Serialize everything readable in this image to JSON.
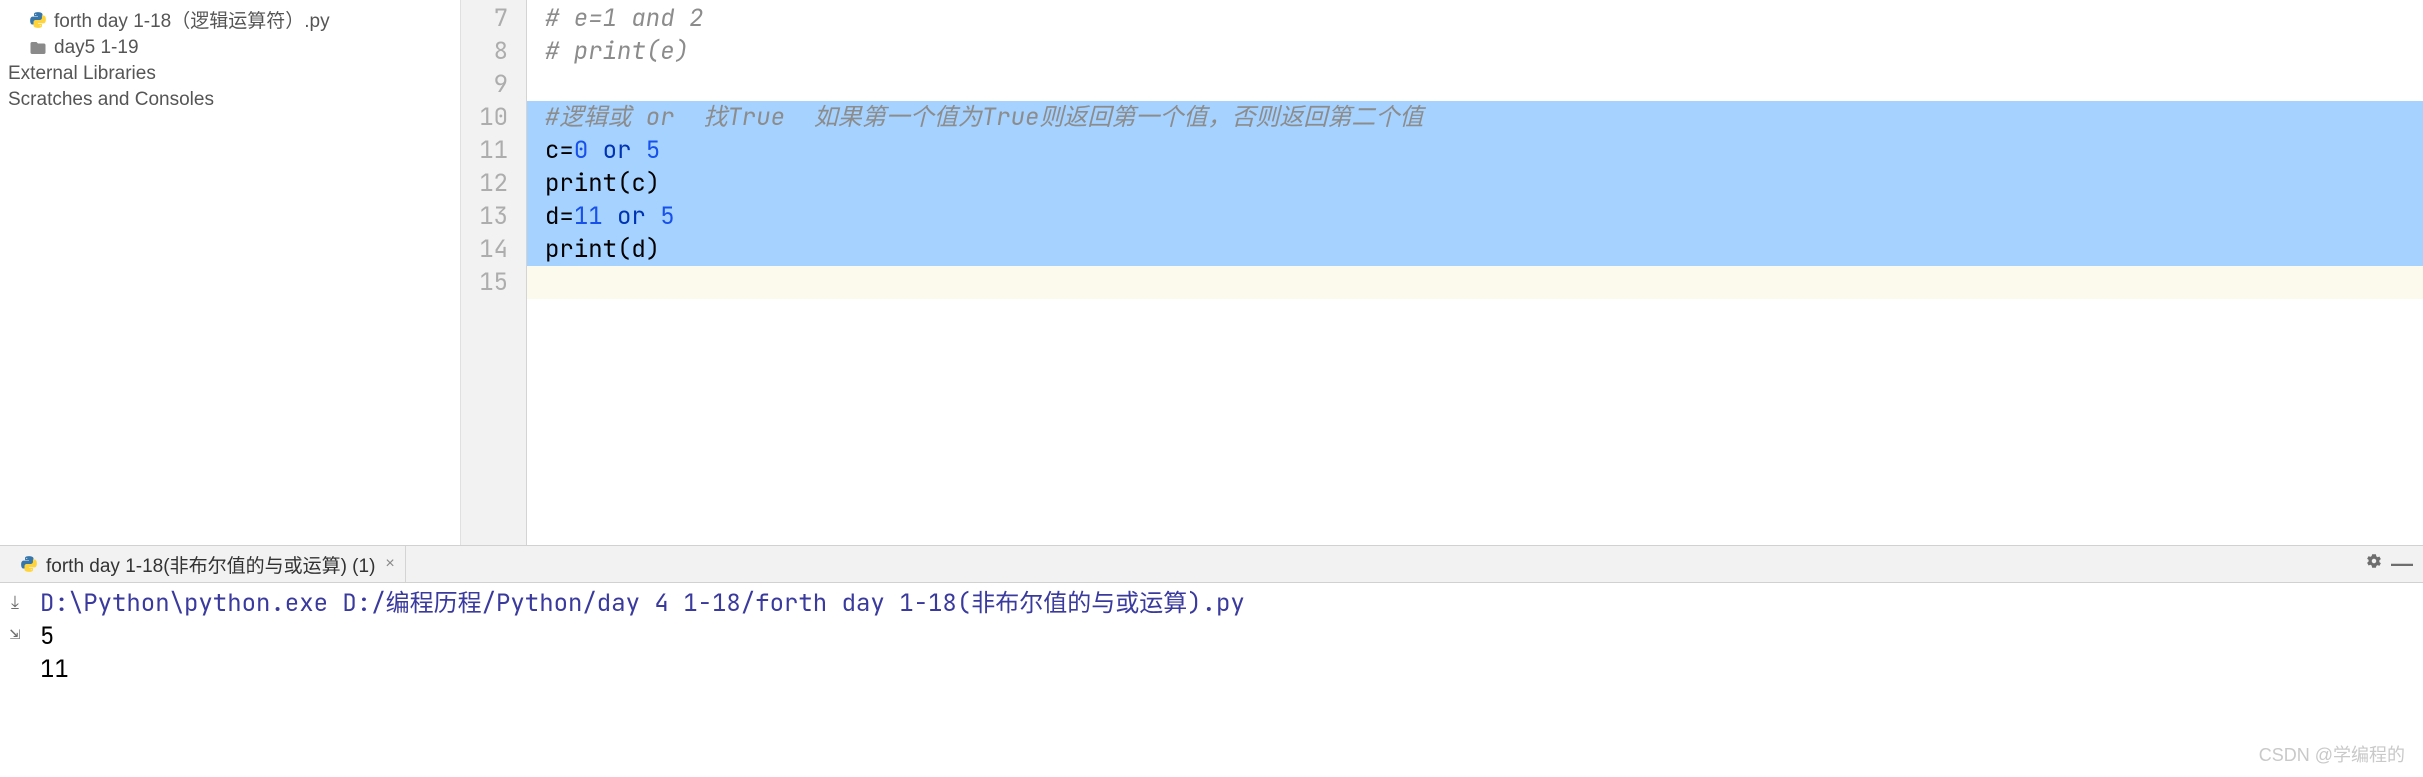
{
  "project_tree": {
    "items": [
      {
        "label": "forth day 1-18（逻辑运算符）.py",
        "type": "py"
      },
      {
        "label": "day5 1-19",
        "type": "folder"
      },
      {
        "label": "External Libraries",
        "type": "lib"
      },
      {
        "label": "Scratches and Consoles",
        "type": "scratch"
      }
    ]
  },
  "editor": {
    "lines": [
      {
        "n": "7",
        "sel": false,
        "tokens": [
          {
            "t": "# e=1 and 2",
            "c": "cmt"
          }
        ]
      },
      {
        "n": "8",
        "sel": false,
        "tokens": [
          {
            "t": "# print(e)",
            "c": "cmt"
          }
        ]
      },
      {
        "n": "9",
        "sel": false,
        "tokens": []
      },
      {
        "n": "10",
        "sel": true,
        "tokens": [
          {
            "t": "#逻辑或 or  找True  如果第一个值为True则返回第一个值，否则返回第二个值",
            "c": "cmt"
          }
        ]
      },
      {
        "n": "11",
        "sel": true,
        "tokens": [
          {
            "t": "c",
            "c": "ident"
          },
          {
            "t": "=",
            "c": "op"
          },
          {
            "t": "0",
            "c": "num"
          },
          {
            "t": " ",
            "c": "op"
          },
          {
            "t": "or",
            "c": "kw"
          },
          {
            "t": " ",
            "c": "op"
          },
          {
            "t": "5",
            "c": "num"
          }
        ]
      },
      {
        "n": "12",
        "sel": true,
        "tokens": [
          {
            "t": "print",
            "c": "fn"
          },
          {
            "t": "(c)",
            "c": "ident"
          }
        ]
      },
      {
        "n": "13",
        "sel": true,
        "tokens": [
          {
            "t": "d",
            "c": "ident"
          },
          {
            "t": "=",
            "c": "op"
          },
          {
            "t": "11",
            "c": "num"
          },
          {
            "t": " ",
            "c": "op"
          },
          {
            "t": "or",
            "c": "kw"
          },
          {
            "t": " ",
            "c": "op"
          },
          {
            "t": "5",
            "c": "num"
          }
        ]
      },
      {
        "n": "14",
        "sel": true,
        "tokens": [
          {
            "t": "print",
            "c": "fn"
          },
          {
            "t": "(d)",
            "c": "ident"
          }
        ]
      },
      {
        "n": "15",
        "sel": false,
        "current": true,
        "tokens": []
      }
    ]
  },
  "run_tab": {
    "label": "forth day 1-18(非布尔值的与或运算) (1)",
    "close": "×"
  },
  "console": {
    "cmd": "D:\\Python\\python.exe  D:/编程历程/Python/day 4 1-18/forth day 1-18(非布尔值的与或运算).py",
    "out": [
      "5",
      "11"
    ]
  },
  "watermark": "CSDN @学编程的"
}
